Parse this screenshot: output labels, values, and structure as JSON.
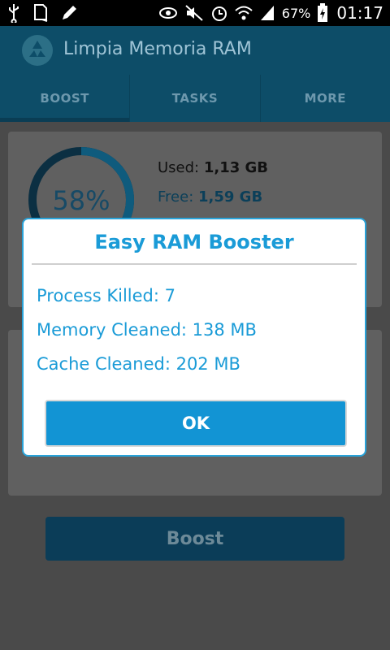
{
  "status_bar": {
    "battery_percent": "67%",
    "time": "01:17",
    "icons": [
      "usb-icon",
      "sd-card-icon",
      "edit-icon",
      "eye-icon",
      "mute-icon",
      "alarm-icon",
      "wifi-icon",
      "signal-icon",
      "battery-charging-icon"
    ]
  },
  "app": {
    "title": "Limpia Memoria RAM",
    "logo_icon": "recycle-icon"
  },
  "tabs": [
    {
      "label": "BOOST",
      "active": true
    },
    {
      "label": "TASKS",
      "active": false
    },
    {
      "label": "MORE",
      "active": false
    }
  ],
  "memory": {
    "percent_label": "58%",
    "usage_fraction": 0.58,
    "used_label": "Used:",
    "used_value": "1,13 GB",
    "free_label": "Free:",
    "free_value": "1,59 GB"
  },
  "boost_button": "Boost",
  "dialog": {
    "title": "Easy RAM Booster",
    "lines": [
      "Process Killed: 7",
      "Memory Cleaned: 138 MB",
      "Cache Cleaned: 202 MB"
    ],
    "ok_label": "OK"
  },
  "colors": {
    "accent": "#1a9bd7",
    "button": "#1294d4",
    "dim_background": "#4a4a4a"
  }
}
